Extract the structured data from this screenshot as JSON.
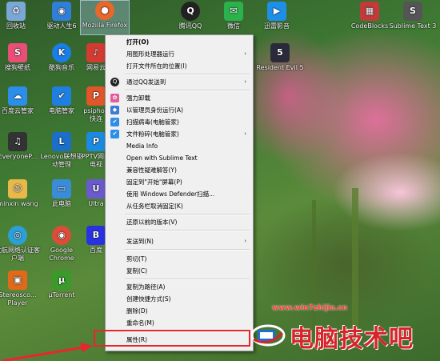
{
  "desktop": {
    "icons": [
      {
        "label": "回收站",
        "icon": "recycle-bin-icon",
        "color": "#7aa7d6"
      },
      {
        "label": "驱动人生6",
        "icon": "driver-life-icon",
        "color": "#2f7fd8"
      },
      {
        "label": "Mozilla Firefox",
        "icon": "firefox-icon",
        "color": "#e8672b"
      },
      {
        "label": "腾讯QQ",
        "icon": "qq-icon",
        "color": "#222222"
      },
      {
        "label": "微信",
        "icon": "wechat-icon",
        "color": "#2bb24c"
      },
      {
        "label": "迅雷影音",
        "icon": "xunlei-player-icon",
        "color": "#1e8fe8"
      },
      {
        "label": "CodeBlocks",
        "icon": "codeblocks-icon",
        "color": "#c33a3a"
      },
      {
        "label": "Sublime Text 3",
        "icon": "sublime-icon",
        "color": "#555555"
      },
      {
        "label": "搜狗壁纸",
        "icon": "sogou-wallpaper-icon",
        "color": "#e94e77"
      },
      {
        "label": "酷狗音乐",
        "icon": "kugou-icon",
        "color": "#1a7ee8"
      },
      {
        "label": "网易云",
        "icon": "netease-icon",
        "color": "#d33a31"
      },
      {
        "label": "Resident Evil 5",
        "icon": "resident-evil-icon",
        "color": "#2a2a3a"
      },
      {
        "label": "百度云管家",
        "icon": "baidu-cloud-icon",
        "color": "#2c8ee8"
      },
      {
        "label": "电脑管家",
        "icon": "pc-manager-icon",
        "color": "#1f7fe0"
      },
      {
        "label": "psiphon 快连",
        "icon": "psiphon-icon",
        "color": "#e0552a"
      },
      {
        "label": "EveryoneP...",
        "icon": "piano-icon",
        "color": "#333333"
      },
      {
        "label": "Lenovo联想驱动管理",
        "icon": "lenovo-icon",
        "color": "#1b6fc8"
      },
      {
        "label": "PPTV网络电视",
        "icon": "pptv-icon",
        "color": "#1a8be0"
      },
      {
        "label": "minxin wang",
        "icon": "user-folder-icon",
        "color": "#e8b84a"
      },
      {
        "label": "此电脑",
        "icon": "this-pc-icon",
        "color": "#3a8bd8"
      },
      {
        "label": "Ultra",
        "icon": "ultra-icon",
        "color": "#6a5acd"
      },
      {
        "label": "沈航网络认证客户端",
        "icon": "network-auth-icon",
        "color": "#2a9fd8"
      },
      {
        "label": "Google Chrome",
        "icon": "chrome-icon",
        "color": "#dd4b39"
      },
      {
        "label": "百度",
        "icon": "baidu-icon",
        "color": "#2932e1"
      },
      {
        "label": "Stereosco... Player",
        "icon": "stereoscopic-player-icon",
        "color": "#e06a1a"
      },
      {
        "label": "μTorrent",
        "icon": "utorrent-icon",
        "color": "#3a9a2a"
      }
    ]
  },
  "context_menu": {
    "items": [
      {
        "label": "打开(O)",
        "bold": true,
        "submenu": false,
        "icon": ""
      },
      {
        "label": "用图形处理器运行",
        "bold": false,
        "submenu": true,
        "icon": ""
      },
      {
        "label": "打开文件所在的位置(I)",
        "bold": false,
        "submenu": false,
        "icon": ""
      },
      {
        "label": "通过QQ发送到",
        "bold": false,
        "submenu": true,
        "icon": "qq-icon"
      },
      {
        "label": "强力卸载",
        "bold": false,
        "submenu": false,
        "icon": "uninstall-icon"
      },
      {
        "label": "以管理员身份运行(A)",
        "bold": false,
        "submenu": false,
        "icon": "shield-icon"
      },
      {
        "label": "扫描病毒(电脑管家)",
        "bold": false,
        "submenu": false,
        "icon": "scan-virus-icon"
      },
      {
        "label": "文件粉碎(电脑管家)",
        "bold": false,
        "submenu": true,
        "icon": "shred-icon"
      },
      {
        "label": "Media Info",
        "bold": false,
        "submenu": false,
        "icon": ""
      },
      {
        "label": "Open with Sublime Text",
        "bold": false,
        "submenu": false,
        "icon": ""
      },
      {
        "label": "兼容性疑难解答(Y)",
        "bold": false,
        "submenu": false,
        "icon": ""
      },
      {
        "label": "固定到\"开始\"屏幕(P)",
        "bold": false,
        "submenu": false,
        "icon": ""
      },
      {
        "label": "使用 Windows Defender扫描...",
        "bold": false,
        "submenu": false,
        "icon": ""
      },
      {
        "label": "从任务栏取消固定(K)",
        "bold": false,
        "submenu": false,
        "icon": ""
      },
      {
        "label": "还原以前的版本(V)",
        "bold": false,
        "submenu": false,
        "icon": ""
      },
      {
        "label": "发送到(N)",
        "bold": false,
        "submenu": true,
        "icon": ""
      },
      {
        "label": "剪切(T)",
        "bold": false,
        "submenu": false,
        "icon": ""
      },
      {
        "label": "复制(C)",
        "bold": false,
        "submenu": false,
        "icon": ""
      },
      {
        "label": "复制为路径(A)",
        "bold": false,
        "submenu": false,
        "icon": ""
      },
      {
        "label": "创建快捷方式(S)",
        "bold": false,
        "submenu": false,
        "icon": ""
      },
      {
        "label": "删除(D)",
        "bold": false,
        "submenu": false,
        "icon": ""
      },
      {
        "label": "重命名(M)",
        "bold": false,
        "submenu": false,
        "icon": ""
      },
      {
        "label": "属性(R)",
        "bold": false,
        "submenu": false,
        "icon": ""
      }
    ]
  },
  "annotation": {
    "highlight_color": "#e8262e"
  },
  "watermark": {
    "url": "www.win7zhijia.cn",
    "brand": "电脑技术吧"
  }
}
